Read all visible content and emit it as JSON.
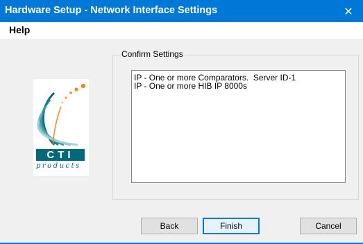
{
  "window": {
    "title": "Hardware Setup - Network Interface Settings",
    "close_glyph": "✕"
  },
  "menu": {
    "items": [
      {
        "label": "Help"
      }
    ]
  },
  "logo": {
    "brand": "CTI",
    "tagline": "products",
    "colors": {
      "teal": "#006a7a",
      "orange": "#f08a1c"
    }
  },
  "confirm": {
    "legend": "Confirm Settings",
    "lines": [
      "IP - One or more Comparators.  Server ID-1",
      "IP - One or more HIB IP 8000s"
    ]
  },
  "buttons": {
    "back": "Back",
    "finish": "Finish",
    "cancel": "Cancel"
  },
  "colors": {
    "titlebar": "#0078d7",
    "accent": "#0078d7"
  }
}
